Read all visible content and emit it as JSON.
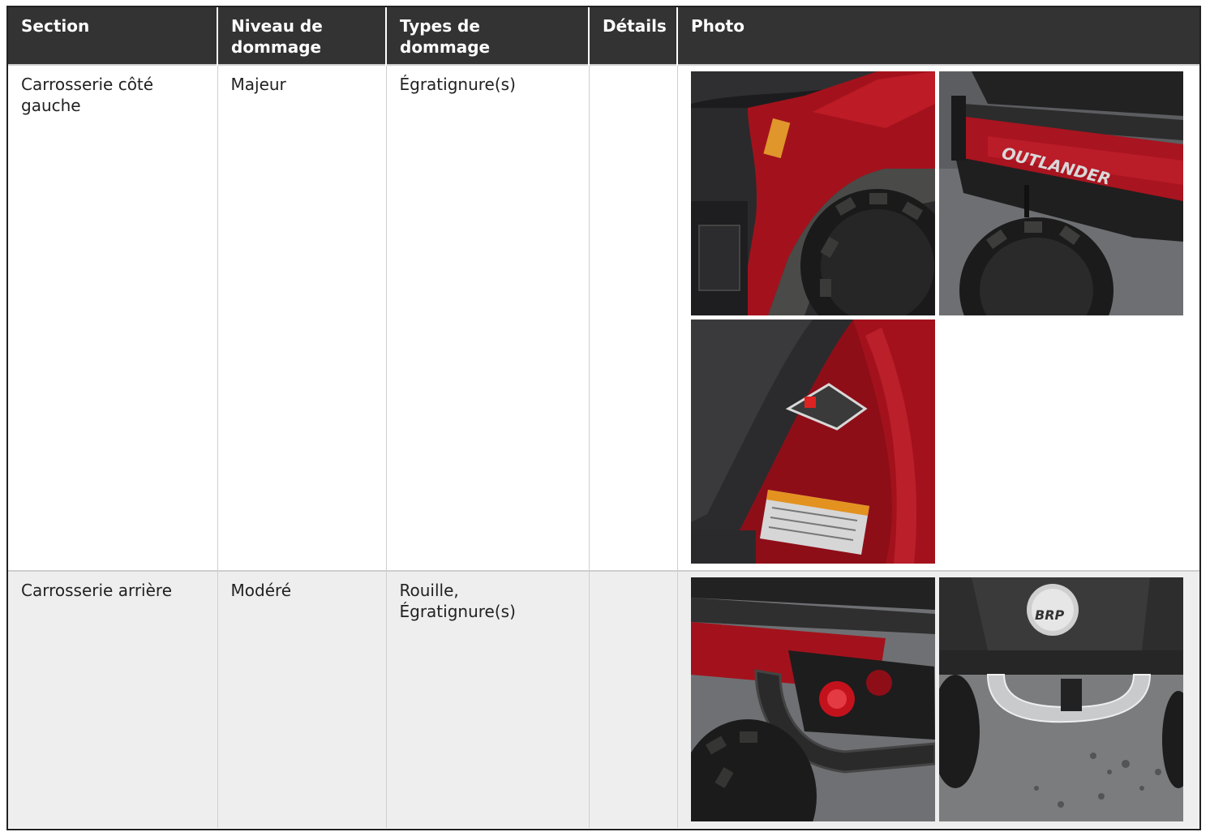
{
  "table": {
    "headers": {
      "section": "Section",
      "level": "Niveau de dommage",
      "types": "Types de dommage",
      "details": "Détails",
      "photo": "Photo"
    },
    "rows": [
      {
        "section": "Carrosserie côté gauche",
        "level": "Majeur",
        "types": "Égratignure(s)",
        "details": "",
        "photos": [
          "Quad rouge, aile arrière gauche avec garde-boue sale",
          "Porte-bagages arrière, logo OUTLANDER",
          "Aile rouge avec étiquettes d'avertissement"
        ]
      },
      {
        "section": "Carrosserie arrière",
        "level": "Modéré",
        "types": "Rouille, Égratignure(s)",
        "details": "",
        "photos": [
          "Pare-chocs arrière et feu rouge",
          "Attache arrière, logo BRP"
        ]
      }
    ]
  },
  "photo_text": {
    "outlander": "OUTLANDER",
    "brp": "BRP"
  },
  "colors": {
    "header_bg": "#333333",
    "header_text": "#ffffff",
    "row_alt_bg": "#eeeeee",
    "atv_red": "#b3141f"
  }
}
